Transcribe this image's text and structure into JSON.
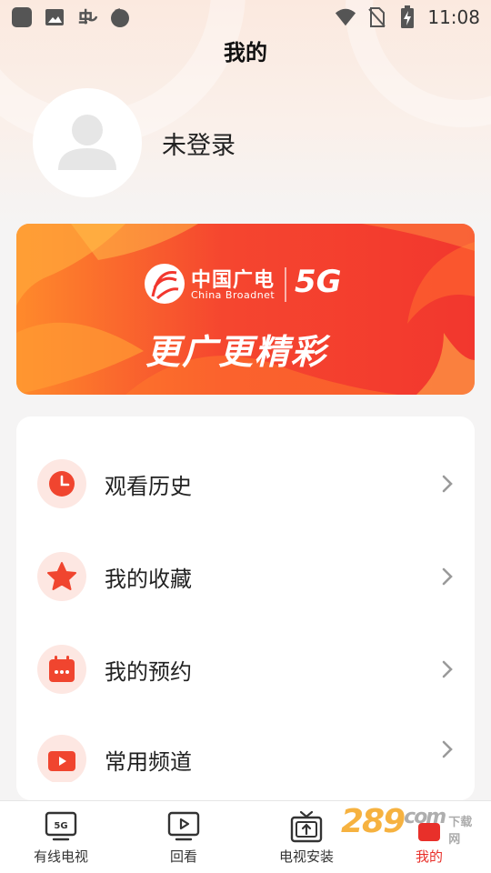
{
  "status_bar": {
    "time": "11:08",
    "left_icons": [
      "app-icon",
      "image-icon",
      "bug-icon",
      "circle-icon"
    ],
    "right_icons": [
      "wifi-icon",
      "no-sim-icon",
      "battery-charging-icon"
    ]
  },
  "header": {
    "title": "我的"
  },
  "profile": {
    "login_status": "未登录"
  },
  "banner": {
    "brand_cn": "中国广电",
    "brand_en": "China Broadnet",
    "badge": "5G",
    "slogan": "更广更精彩"
  },
  "menu": {
    "items": [
      {
        "label": "观看历史",
        "icon": "clock-icon"
      },
      {
        "label": "我的收藏",
        "icon": "star-icon"
      },
      {
        "label": "我的预约",
        "icon": "calendar-icon"
      },
      {
        "label": "常用频道",
        "icon": "tv-icon"
      }
    ]
  },
  "tabbar": {
    "tabs": [
      {
        "label": "有线电视",
        "icon": "5g-tv-icon",
        "badge": "5G",
        "active": false
      },
      {
        "label": "回看",
        "icon": "play-icon",
        "active": false
      },
      {
        "label": "电视安装",
        "icon": "tv-upload-icon",
        "active": false
      },
      {
        "label": "我的",
        "icon": "profile-icon",
        "active": true
      }
    ]
  },
  "watermark": {
    "main": "289",
    "sub": "com",
    "site": "下载网"
  },
  "colors": {
    "accent": "#e8302a",
    "banner_start": "#ff8a2b",
    "banner_end": "#f2372e",
    "icon_bg": "#fde7e2"
  }
}
